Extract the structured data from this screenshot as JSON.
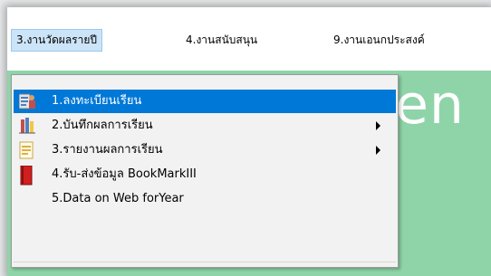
{
  "menubar": {
    "items": [
      {
        "label": "3.งานวัดผลรายปี"
      },
      {
        "label": "4.งานสนับสนุน"
      },
      {
        "label": "9.งานเอนกประสงค์"
      }
    ]
  },
  "background": {
    "text": "en"
  },
  "dropdown": {
    "items": [
      {
        "label": "1.ลงทะเบียนเรียน",
        "icon": "register-icon",
        "selected": true
      },
      {
        "label": "2.บันทึกผลการเรียน",
        "icon": "record-grades-icon",
        "has_submenu": true
      },
      {
        "label": "3.รายงานผลการเรียน",
        "icon": "report-icon",
        "has_submenu": true
      },
      {
        "label": "4.รับ-ส่งข้อมูล BookMarkIII",
        "icon": "red-book-icon"
      },
      {
        "label": "5.Data on Web forYear",
        "icon": ""
      }
    ]
  },
  "colors": {
    "accent": "#0078d7",
    "background_green": "#8fd4a8"
  }
}
